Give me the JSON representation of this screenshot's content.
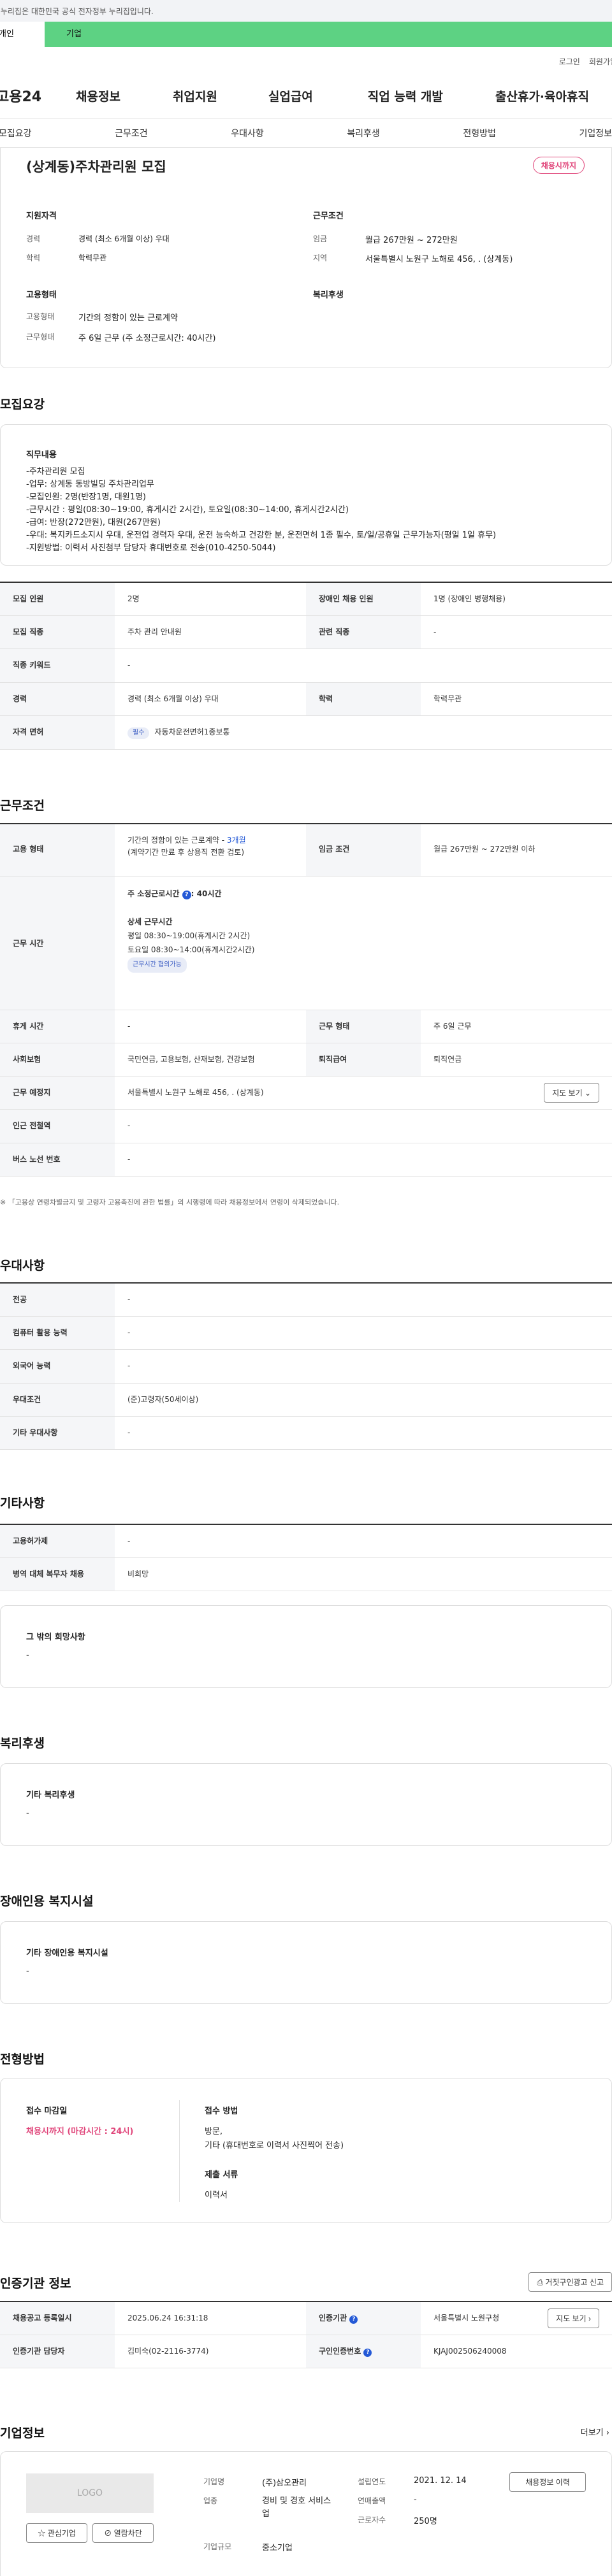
{
  "gov_notice": "이 누리집은 대한민국 공식 전자정부 누리집입니다.",
  "site_tabs": [
    "개인",
    "기업"
  ],
  "util": {
    "login": "로그인",
    "join": "회원가입"
  },
  "gnb": {
    "logo": "고용24",
    "menus": [
      "채용정보",
      "취업지원",
      "실업급여",
      "직업 능력 개발",
      "출산휴가·육아휴직"
    ]
  },
  "subnav": [
    "모집요강",
    "근무조건",
    "우대사항",
    "복리후생",
    "전형방법",
    "기업정보"
  ],
  "summary": {
    "title": "(상계동)주차관리원 모집",
    "status": "채용시까지",
    "qual_title": "지원자격",
    "cond_title": "근무조건",
    "career_label": "경력",
    "career_value": "경력 (최소 6개월 이상) 우대",
    "edu_label": "학력",
    "edu_value": "학력무관",
    "wage_label": "임금",
    "wage_value": "월급 267만원 ~ 272만원",
    "region_label": "지역",
    "region_value": "서울특별시 노원구 노해로 456, . (상계동)",
    "form_title": "고용형태",
    "welfare_title": "복리후생",
    "emp_label": "고용형태",
    "emp_value": "기간의 정함이 있는 근로계약",
    "work_label": "근무형태",
    "work_value": "주 6일 근무 (주 소정근로시간: 40시간)"
  },
  "recruit": {
    "section_title": "모집요강",
    "duty_title": "직무내용",
    "duty_lines": [
      "-주차관리원 모집",
      "-업무: 상계동 동방빌딩 주차관리업무",
      "-모집인원: 2명(반장1명, 대원1명)",
      "-근무시간 : 평일(08:30~19:00, 휴게시간 2시간), 토요일(08:30~14:00, 휴게시간2시간)",
      "-급여: 반장(272만원), 대원(267만원)",
      "-우대: 복지카드소지시 우대, 운전업 경력자 우대, 운전 능숙하고 건강한 분, 운전면허 1종 필수, 토/일/공휴일 근무가능자(평일 1일 휴무)",
      "-지원방법: 이력서 사진첨부 담당자 휴대번호로 전송(010-4250-5044)"
    ],
    "rows": {
      "count_l": "모집 인원",
      "count_v": "2명",
      "dis_l": "장애인 채용 인원",
      "dis_v": "1명 (장애인 병행채용)",
      "job_l": "모집 직종",
      "job_v": "주차 관리 안내원",
      "rel_l": "관련 직종",
      "rel_v": "-",
      "kw_l": "직종 키워드",
      "kw_v": "-",
      "career_l": "경력",
      "career_v": "경력 (최소 6개월 이상) 우대",
      "edu_l": "학력",
      "edu_v": "학력무관",
      "lic_l": "자격 면허",
      "lic_tag": "필수",
      "lic_v": "자동차운전면허1종보통"
    }
  },
  "cond": {
    "section_title": "근무조건",
    "emp_l": "고용 형태",
    "emp_v": "기간의 정함이 있는 근로계약 - ",
    "emp_months": "3개월",
    "emp_note": "(계약기간 만료 후 상용직 전환 검토)",
    "wage_l": "임금 조건",
    "wage_v": "월급 267만원 ~ 272만원 이하",
    "time_l": "근무 시간",
    "time_head": "주 소정근로시간",
    "time_hours": ": 40시간",
    "time_detail_title": "상세 근무시간",
    "time_weekday": "평일 08:30~19:00(휴게시간 2시간)",
    "time_sat": "토요일 08:30~14:00(휴게시간2시간)",
    "time_tag": "근무시간 협의가능",
    "rest_l": "휴게 시간",
    "rest_v": "-",
    "form_l": "근무 형태",
    "form_v": "주 6일 근무",
    "ins_l": "사회보험",
    "ins_v": "국민연금, 고용보험, 산재보험, 건강보험",
    "ret_l": "퇴직급여",
    "ret_v": "퇴직연금",
    "place_l": "근무 예정지",
    "place_v": "서울특별시 노원구 노해로 456, . (상계동)",
    "map_btn": "지도 보기",
    "subway_l": "인근 전철역",
    "subway_v": "-",
    "bus_l": "버스 노선 번호",
    "bus_v": "-",
    "notice": "「고용상 연령차별금지 및 고령자 고용촉진에 관한 법률」의 시행령에 따라 채용정보에서 연령이 삭제되었습니다."
  },
  "pref": {
    "section_title": "우대사항",
    "major_l": "전공",
    "major_v": "-",
    "pc_l": "컴퓨터 활용 능력",
    "pc_v": "-",
    "lang_l": "외국어 능력",
    "lang_v": "-",
    "cond_l": "우대조건",
    "cond_v": "(준)고령자(50세이상)",
    "etc_l": "기타 우대사항",
    "etc_v": "-"
  },
  "other": {
    "section_title": "기타사항",
    "tool_l": "고용허가제",
    "tool_v": "-",
    "mil_l": "병역 대체 복무자 채용",
    "mil_v": "비희망",
    "hope_title": "그 밖의 희망사항",
    "hope_v": "-"
  },
  "welfare": {
    "section_title": "복리후생",
    "box_title": "기타 복리후생",
    "box_v": "-"
  },
  "disab": {
    "section_title": "장애인용 복지시설",
    "box_title": "기타 장애인용 복지시설",
    "box_v": "-"
  },
  "select": {
    "section_title": "전형방법",
    "deadline_title": "접수 마감일",
    "deadline_v": "채용시까지 (마감시간 : 24시)",
    "method_title": "접수 방법",
    "method_v1": "방문,",
    "method_v2": "기타 (휴대번호로 이력서 사진찍어 전송)",
    "docs_title": "제출 서류",
    "docs_v": "이력서"
  },
  "cert": {
    "section_title": "인증기관 정보",
    "report_btn": "거짓구인광고 신고",
    "reg_l": "채용공고 등록일시",
    "reg_v": "2025.06.24 16:31:18",
    "org_l": "인증기관",
    "org_v": "서울특별시 노원구청",
    "map_btn": "지도 보기",
    "mgr_l": "인증기관 담당자",
    "mgr_v": "김미숙(02-2116-3774)",
    "no_l": "구인인증번호",
    "no_v": "KJAJ002506240008"
  },
  "company": {
    "section_title": "기업정보",
    "more": "더보기",
    "logo": "LOGO",
    "fav_btn": "관심기업",
    "block_btn": "열람차단",
    "name_l": "기업명",
    "name_v": "(주)삼오관리",
    "ind_l": "업종",
    "ind_v": "경비 및 경호 서비스업",
    "size_l": "기업규모",
    "size_v": "중소기업",
    "est_l": "설립연도",
    "est_v": "2021. 12. 14",
    "sales_l": "연매출액",
    "sales_v": "-",
    "emp_l": "근로자수",
    "emp_v": "250명",
    "history_btn": "채용정보 이력"
  }
}
